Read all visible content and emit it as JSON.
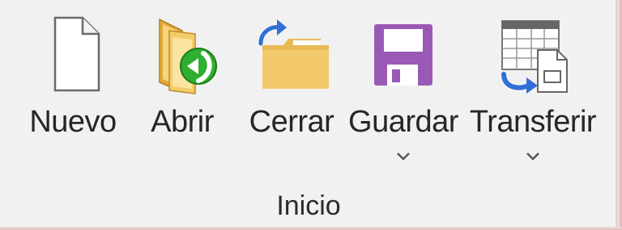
{
  "ribbon": {
    "group_label": "Inicio",
    "buttons": [
      {
        "label": "Nuevo",
        "icon": "new-document-icon",
        "has_dropdown": false
      },
      {
        "label": "Abrir",
        "icon": "open-folder-icon",
        "has_dropdown": false
      },
      {
        "label": "Cerrar",
        "icon": "close-folder-icon",
        "has_dropdown": false
      },
      {
        "label": "Guardar",
        "icon": "save-disk-icon",
        "has_dropdown": true
      },
      {
        "label": "Transferir",
        "icon": "transfer-icon",
        "has_dropdown": true
      }
    ],
    "colors": {
      "background": "#f1f1f1",
      "save_purple": "#9b59b6",
      "open_green": "#2f9e2f",
      "folder_yellow": "#f0c96a",
      "arrow_blue": "#2f6fd6"
    }
  }
}
